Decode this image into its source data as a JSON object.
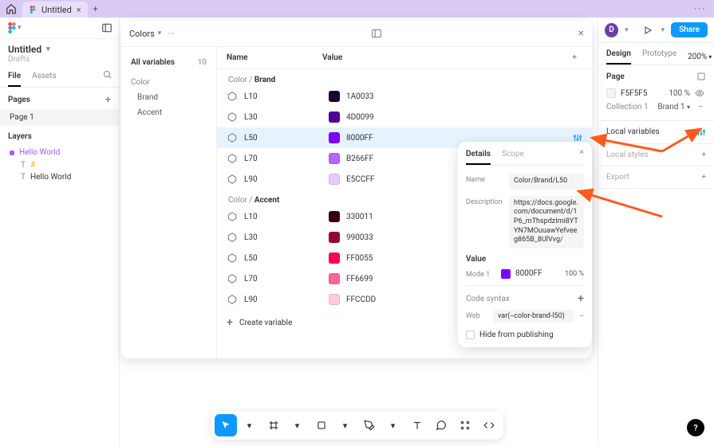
{
  "titlebar": {
    "tab_title": "Untitled",
    "plus": "+",
    "dots": "···"
  },
  "left": {
    "title": "Untitled",
    "subtitle": "Drafts",
    "tabs": {
      "file": "File",
      "assets": "Assets"
    },
    "pages_label": "Pages",
    "page1": "Page 1",
    "layers_label": "Layers",
    "hello": "Hello World",
    "child_hash": "#",
    "child_text": "Hello World"
  },
  "right": {
    "avatar": "D",
    "share": "Share",
    "tabs": {
      "design": "Design",
      "prototype": "Prototype",
      "zoom": "200%"
    },
    "page_label": "Page",
    "page_color": "F5F5F5",
    "page_opacity": "100",
    "pct": "%",
    "collection_label": "Collection 1",
    "collection_value": "Brand 1",
    "local_vars": "Local variables",
    "local_styles": "Local styles",
    "export": "Export"
  },
  "vars": {
    "collection_select": "Colors",
    "side_head": "All variables",
    "side_count": "10",
    "group_color": "Color",
    "group_brand": "Brand",
    "group_accent": "Accent",
    "col_name": "Name",
    "col_value": "Value",
    "breadcrumb_color": "Color",
    "breadcrumb_brand": "Brand",
    "breadcrumb_accent": "Accent",
    "brand": [
      {
        "name": "L10",
        "hex": "1A0033",
        "color": "#1A0033"
      },
      {
        "name": "L30",
        "hex": "4D0099",
        "color": "#4D0099"
      },
      {
        "name": "L50",
        "hex": "8000FF",
        "color": "#8000FF"
      },
      {
        "name": "L70",
        "hex": "B266FF",
        "color": "#B266FF"
      },
      {
        "name": "L90",
        "hex": "E5CCFF",
        "color": "#E5CCFF"
      }
    ],
    "accent": [
      {
        "name": "L10",
        "hex": "330011",
        "color": "#330011"
      },
      {
        "name": "L30",
        "hex": "990033",
        "color": "#990033"
      },
      {
        "name": "L50",
        "hex": "FF0055",
        "color": "#FF0055"
      },
      {
        "name": "L70",
        "hex": "FF6699",
        "color": "#FF6699"
      },
      {
        "name": "L90",
        "hex": "FFCCDD",
        "color": "#FFCCDD"
      }
    ],
    "create": "Create variable"
  },
  "details": {
    "tab_details": "Details",
    "tab_scope": "Scope",
    "name_label": "Name",
    "name_value": "Color/Brand/L50",
    "desc_label": "Description",
    "desc_value": "https://docs.google.com/document/d/1P6_mThspdzImi8YTYN7MOuuawYefveeg865B_8UlVvg/",
    "value_label": "Value",
    "mode_label": "Mode 1",
    "mode_hex": "8000FF",
    "mode_pct": "100",
    "pct": "%",
    "code_syntax": "Code syntax",
    "web_label": "Web",
    "web_value": "var(--color-brand-l50)",
    "hide": "Hide from publishing"
  }
}
